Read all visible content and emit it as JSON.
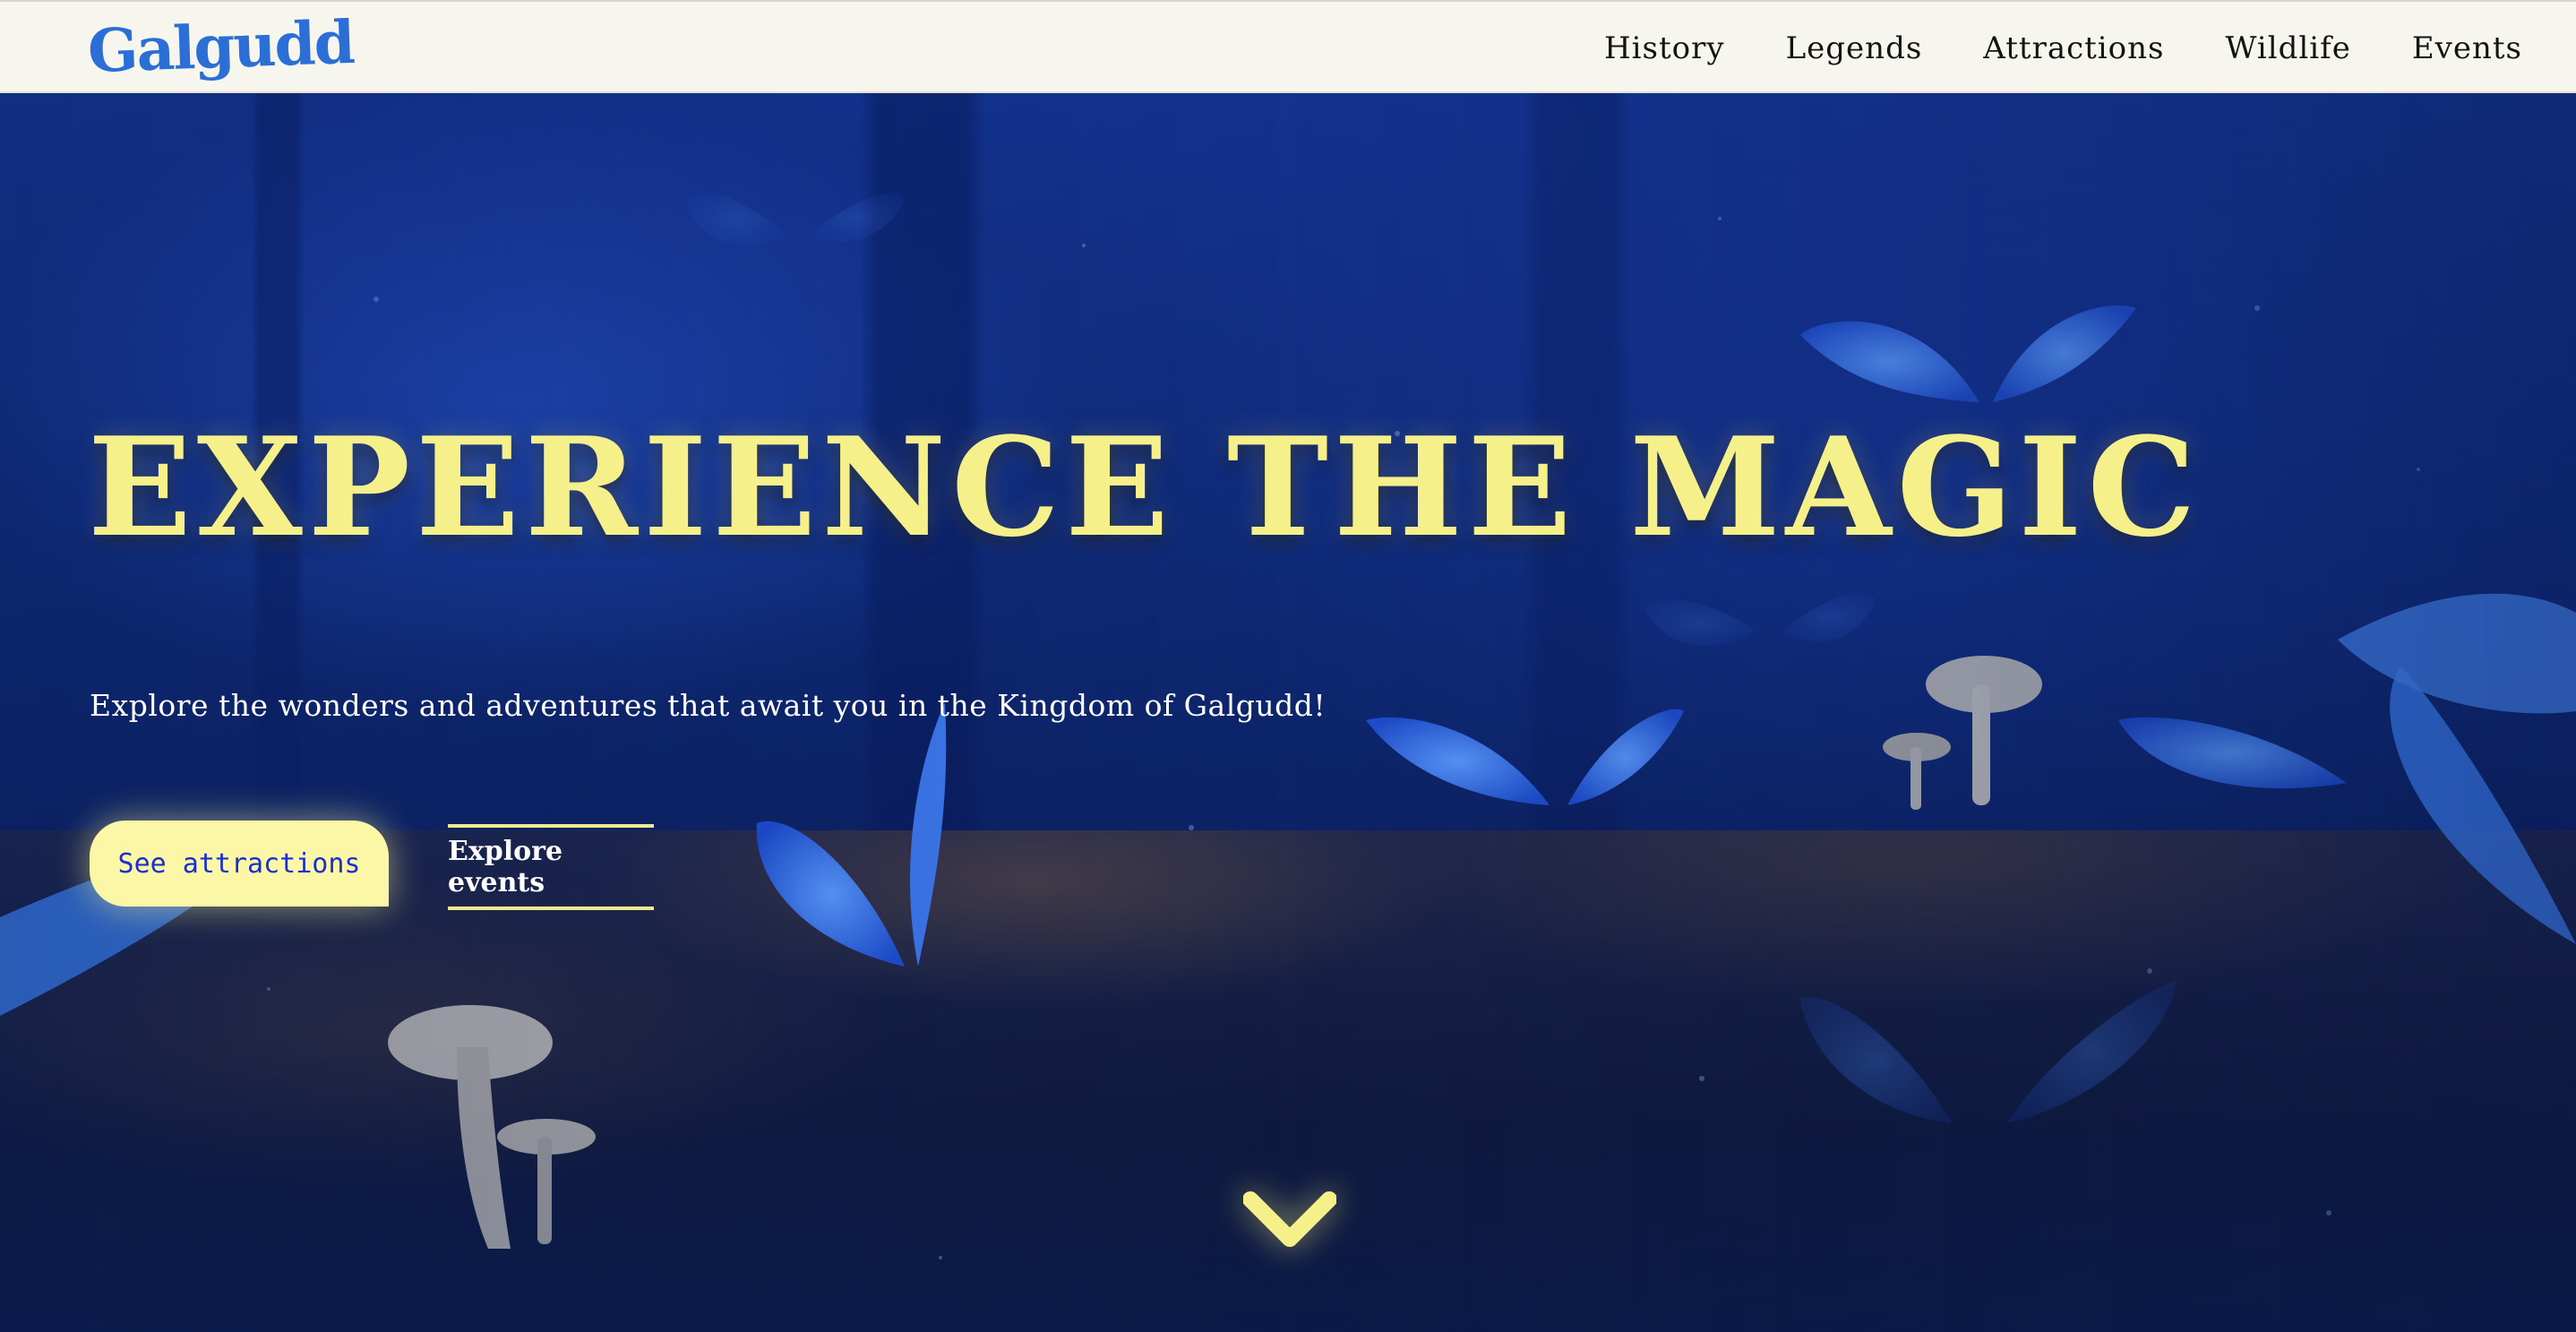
{
  "brand": {
    "name": "Galgudd"
  },
  "nav": {
    "items": [
      {
        "label": "History"
      },
      {
        "label": "Legends"
      },
      {
        "label": "Attractions"
      },
      {
        "label": "Wildlife"
      },
      {
        "label": "Events"
      }
    ]
  },
  "hero": {
    "title": "EXPERIENCE THE MAGIC",
    "subtitle": "Explore the wonders and adventures that await you in the Kingdom of Galgudd!",
    "primary_button": "See attractions",
    "secondary_button": "Explore events",
    "scroll_icon": "chevron-down-icon"
  },
  "colors": {
    "nav_background": "#f6f5ee",
    "logo": "#2b6fd6",
    "title": "#f6f08a",
    "primary_button_bg": "#fbf7a6",
    "primary_button_text": "#1b2fd0",
    "hero_background": "#0f2a78"
  }
}
